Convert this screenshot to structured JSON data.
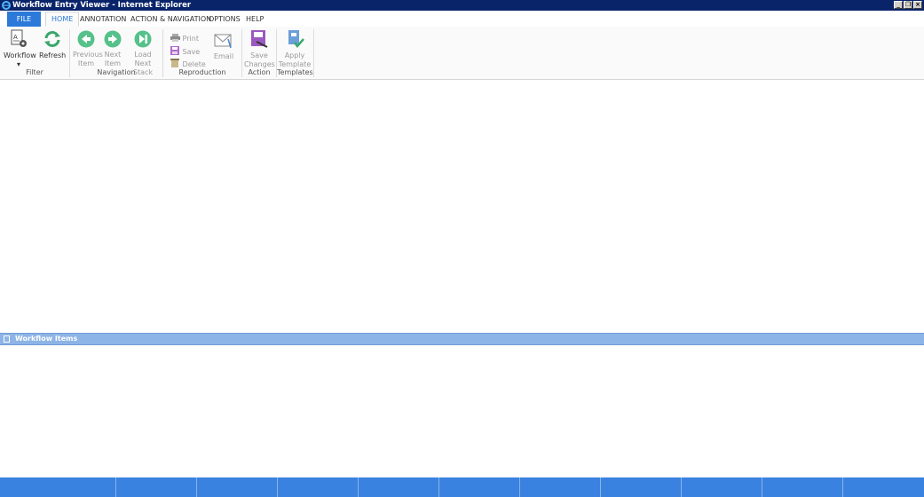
{
  "window": {
    "title": "Workflow Entry Viewer - Internet Explorer",
    "buttons": [
      "minimize",
      "restore",
      "close"
    ]
  },
  "menu": {
    "file": "FILE",
    "tabs": [
      "HOME",
      "ANNOTATION",
      "ACTION & NAVIGATION",
      "OPTIONS",
      "HELP"
    ],
    "active": "HOME"
  },
  "ribbon": {
    "filter": {
      "workflow_line1": "Workflow",
      "workflow_arrow": "▾",
      "refresh": "Refresh",
      "group": "Filter"
    },
    "navigation": {
      "previous_l1": "Previous",
      "previous_l2": "Item",
      "next_l1": "Next",
      "next_l2": "Item",
      "loadnext_l1": "Load Next",
      "loadnext_l2": "Stack",
      "group": "Navigation"
    },
    "reproduction": {
      "print": "Print",
      "save": "Save",
      "delete": "Delete",
      "email": "Email",
      "group": "Reproduction"
    },
    "action": {
      "save_l1": "Save",
      "save_l2": "Changes",
      "group": "Action"
    },
    "templates": {
      "apply_l1": "Apply",
      "apply_l2": "Template",
      "group": "Templates"
    }
  },
  "pane": {
    "title": "Workflow Items"
  },
  "colors": {
    "accent": "#2b7ad9",
    "status": "#3a82e0",
    "pane": "#8db4e6",
    "nav_green": "#56c18a"
  }
}
